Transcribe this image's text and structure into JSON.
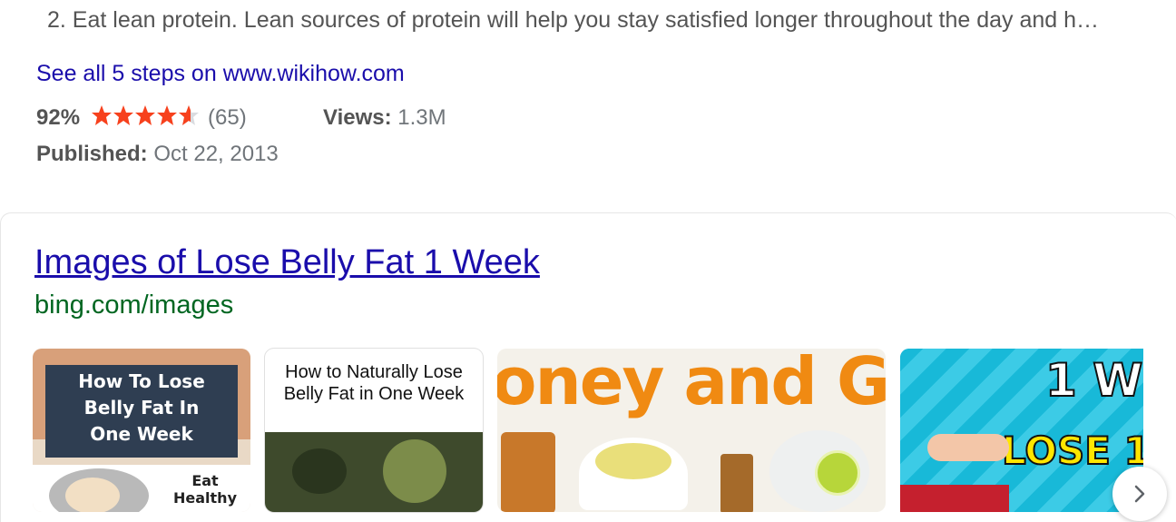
{
  "step2": "2. Eat lean protein. Lean sources of protein will help you stay satisfied longer throughout the day and h…",
  "see_all": "See all 5 steps on www.wikihow.com",
  "rating": {
    "percent": "92%",
    "stars": 4.6,
    "count": "(65)"
  },
  "views": {
    "label": "Views:",
    "value": "1.3M"
  },
  "published": {
    "label": "Published:",
    "value": "Oct 22, 2013"
  },
  "images": {
    "title": "Images of Lose Belly Fat 1 Week",
    "url": "bing.com/images",
    "thumbs": [
      {
        "caption_lines": [
          "How To Lose",
          "Belly Fat In",
          "One Week"
        ],
        "sub_lines": [
          "Eat",
          "Healthy"
        ]
      },
      {
        "caption_lines": [
          "How to Naturally Lose",
          "Belly Fat in One Week"
        ]
      },
      {
        "caption": "oney and Garl"
      },
      {
        "caption_lines": [
          "1 W",
          "LOSE 1"
        ]
      }
    ]
  },
  "colors": {
    "link": "#1a0dab",
    "url_green": "#006621",
    "star": "#f7411d"
  },
  "icons": {
    "next": "chevron-right-icon"
  }
}
